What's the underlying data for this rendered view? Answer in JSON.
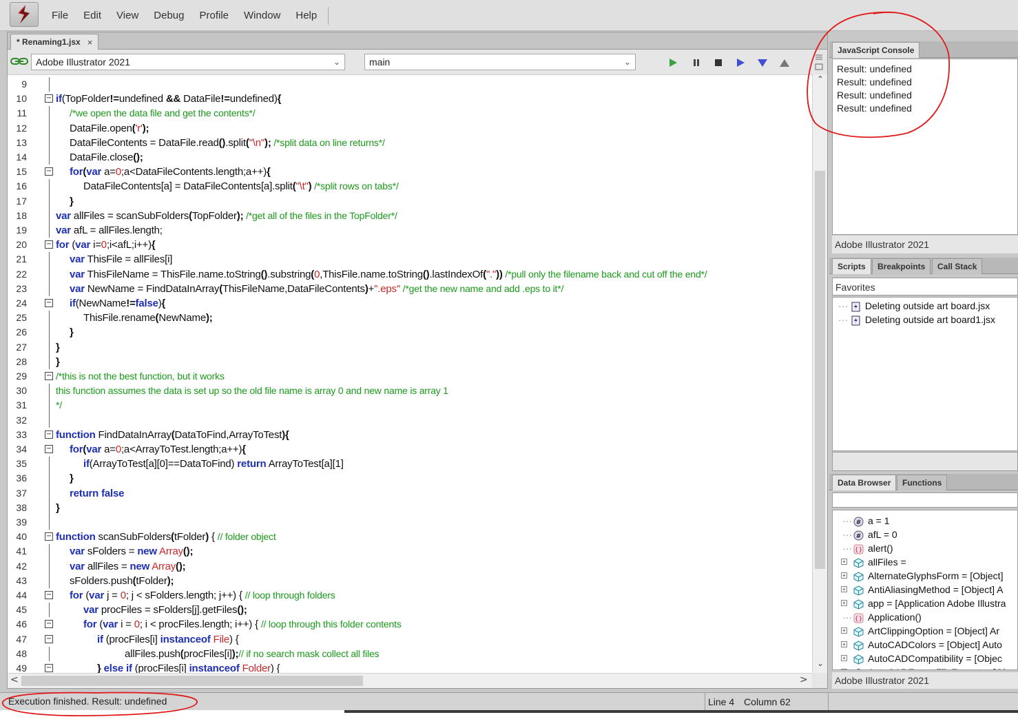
{
  "menubar": {
    "items": [
      "File",
      "Edit",
      "View",
      "Debug",
      "Profile",
      "Window",
      "Help"
    ]
  },
  "editor": {
    "tab_label": "* Renaming1.jsx",
    "tab_close": "×",
    "target": "Adobe Illustrator 2021",
    "function": "main",
    "toolbar_icons": [
      "run-icon",
      "pause-icon",
      "stop-icon",
      "step-over-icon",
      "step-into-icon",
      "step-out-icon"
    ],
    "scroll_left": "<",
    "scroll_right": ">",
    "lines": [
      {
        "n": "9",
        "indent": 0,
        "segs": []
      },
      {
        "n": "10",
        "indent": 0,
        "segs": [
          [
            "kw",
            "if"
          ],
          [
            "",
            "(TopFolder"
          ],
          [
            "op",
            "!="
          ],
          [
            "",
            "undefined "
          ],
          [
            "op",
            "&&"
          ],
          [
            "",
            " DataFile"
          ],
          [
            "op",
            "!="
          ],
          [
            "",
            "undefined)"
          ],
          [
            "op",
            "{"
          ]
        ]
      },
      {
        "n": "11",
        "indent": 1,
        "segs": [
          [
            "cm",
            "/*we open the data file and get the contents*/"
          ]
        ]
      },
      {
        "n": "12",
        "indent": 1,
        "segs": [
          [
            "",
            "DataFile.open"
          ],
          [
            "op",
            "("
          ],
          [
            "st",
            "'r'"
          ],
          [
            "op",
            ");"
          ]
        ]
      },
      {
        "n": "13",
        "indent": 1,
        "segs": [
          [
            "",
            "DataFileContents = DataFile.read"
          ],
          [
            "op",
            "()"
          ],
          [
            "",
            ".split"
          ],
          [
            "op",
            "("
          ],
          [
            "st",
            "\"\\n\""
          ],
          [
            "op",
            ");"
          ],
          [
            "cm",
            " /*split data on line returns*/"
          ]
        ]
      },
      {
        "n": "14",
        "indent": 1,
        "segs": [
          [
            "",
            "DataFile.close"
          ],
          [
            "op",
            "();"
          ]
        ]
      },
      {
        "n": "15",
        "indent": 1,
        "segs": [
          [
            "kw",
            "for"
          ],
          [
            "op",
            "("
          ],
          [
            "kw",
            "var"
          ],
          [
            "",
            " a="
          ],
          [
            "nm",
            "0"
          ],
          [
            "",
            ";a<DataFileContents.length;a++)"
          ],
          [
            "op",
            "{"
          ]
        ]
      },
      {
        "n": "16",
        "indent": 2,
        "segs": [
          [
            "",
            "DataFileContents[a] = DataFileContents[a].split"
          ],
          [
            "op",
            "("
          ],
          [
            "st",
            "\"\\t\""
          ],
          [
            "op",
            ")"
          ],
          [
            "cm",
            " /*split rows on tabs*/"
          ]
        ]
      },
      {
        "n": "17",
        "indent": 1,
        "segs": [
          [
            "op",
            "}"
          ]
        ]
      },
      {
        "n": "18",
        "indent": 0,
        "segs": [
          [
            "kw",
            "var"
          ],
          [
            "",
            " allFiles = scanSubFolders"
          ],
          [
            "op",
            "("
          ],
          [
            "",
            "TopFolder"
          ],
          [
            "op",
            ");"
          ],
          [
            "cm",
            " /*get all of the files in the TopFolder*/"
          ]
        ]
      },
      {
        "n": "19",
        "indent": 0,
        "segs": [
          [
            "kw",
            "var"
          ],
          [
            "",
            " afL = allFiles.length;"
          ]
        ]
      },
      {
        "n": "20",
        "indent": 0,
        "segs": [
          [
            "kw",
            "for"
          ],
          [
            "",
            " ("
          ],
          [
            "kw",
            "var"
          ],
          [
            "",
            " i="
          ],
          [
            "nm",
            "0"
          ],
          [
            "",
            ";i<afL;i++)"
          ],
          [
            "op",
            "{"
          ]
        ]
      },
      {
        "n": "21",
        "indent": 1,
        "segs": [
          [
            "kw",
            "var"
          ],
          [
            "",
            " ThisFile = allFiles[i]"
          ]
        ]
      },
      {
        "n": "22",
        "indent": 1,
        "segs": [
          [
            "kw",
            "var"
          ],
          [
            "",
            " ThisFileName = ThisFile.name.toString"
          ],
          [
            "op",
            "()"
          ],
          [
            "",
            ".substring"
          ],
          [
            "op",
            "("
          ],
          [
            "nm",
            "0"
          ],
          [
            "",
            ",ThisFile.name.toString"
          ],
          [
            "op",
            "()"
          ],
          [
            "",
            ".lastIndexOf"
          ],
          [
            "op",
            "("
          ],
          [
            "st",
            "\".\""
          ],
          [
            "op",
            "))"
          ],
          [
            "cm",
            " /*pull only the filename back and cut off the end*/"
          ]
        ]
      },
      {
        "n": "23",
        "indent": 1,
        "segs": [
          [
            "kw",
            "var"
          ],
          [
            "",
            " NewName = FindDataInArray"
          ],
          [
            "op",
            "("
          ],
          [
            "",
            "ThisFileName,DataFileContents"
          ],
          [
            "op",
            ")"
          ],
          [
            "",
            "+"
          ],
          [
            "st",
            "\".eps\""
          ],
          [
            "cm",
            " /*get the new name and add .eps to it*/"
          ]
        ]
      },
      {
        "n": "24",
        "indent": 1,
        "segs": [
          [
            "kw",
            "if"
          ],
          [
            "",
            "(NewName"
          ],
          [
            "op",
            "!="
          ],
          [
            "kw",
            "false"
          ],
          [
            "",
            ")"
          ],
          [
            "op",
            "{"
          ]
        ]
      },
      {
        "n": "25",
        "indent": 2,
        "segs": [
          [
            "",
            "ThisFile.rename"
          ],
          [
            "op",
            "("
          ],
          [
            "",
            "NewName"
          ],
          [
            "op",
            ");"
          ]
        ]
      },
      {
        "n": "26",
        "indent": 1,
        "segs": [
          [
            "op",
            "}"
          ]
        ]
      },
      {
        "n": "27",
        "indent": 0,
        "segs": [
          [
            "op",
            "}"
          ]
        ]
      },
      {
        "n": "28",
        "indent": 0,
        "segs": [
          [
            "op",
            "}"
          ]
        ]
      },
      {
        "n": "29",
        "indent": 0,
        "segs": [
          [
            "cm",
            "/*this is not the best function, but it works"
          ]
        ]
      },
      {
        "n": "30",
        "indent": 0,
        "segs": [
          [
            "cm",
            "this function assumes the data is set up so the old file name is array 0 and new name is array 1"
          ]
        ]
      },
      {
        "n": "31",
        "indent": 0,
        "segs": [
          [
            "cm",
            "*/"
          ]
        ]
      },
      {
        "n": "32",
        "indent": 0,
        "segs": []
      },
      {
        "n": "33",
        "indent": 0,
        "segs": [
          [
            "kw",
            "function"
          ],
          [
            "",
            " FindDataInArray"
          ],
          [
            "op",
            "("
          ],
          [
            "",
            "DataToFind,ArrayToTest"
          ],
          [
            "op",
            "){"
          ]
        ]
      },
      {
        "n": "34",
        "indent": 1,
        "segs": [
          [
            "kw",
            "for"
          ],
          [
            "op",
            "("
          ],
          [
            "kw",
            "var"
          ],
          [
            "",
            " a="
          ],
          [
            "nm",
            "0"
          ],
          [
            "",
            ";a<ArrayToTest.length;a++)"
          ],
          [
            "op",
            "{"
          ]
        ]
      },
      {
        "n": "35",
        "indent": 2,
        "segs": [
          [
            "kw",
            "if"
          ],
          [
            "",
            "(ArrayToTest[a][0]==DataToFind) "
          ],
          [
            "kw",
            "return"
          ],
          [
            "",
            " ArrayToTest[a][1]"
          ]
        ]
      },
      {
        "n": "36",
        "indent": 1,
        "segs": [
          [
            "op",
            "}"
          ]
        ]
      },
      {
        "n": "37",
        "indent": 1,
        "segs": [
          [
            "kw",
            "return false"
          ]
        ]
      },
      {
        "n": "38",
        "indent": 0,
        "segs": [
          [
            "op",
            "}"
          ]
        ]
      },
      {
        "n": "39",
        "indent": 0,
        "segs": []
      },
      {
        "n": "40",
        "indent": 0,
        "segs": [
          [
            "kw",
            "function"
          ],
          [
            "",
            " scanSubFolders"
          ],
          [
            "op",
            "("
          ],
          [
            "",
            "tFolder"
          ],
          [
            "op",
            ")"
          ],
          [
            "",
            " { "
          ],
          [
            "cm",
            "// folder object"
          ]
        ]
      },
      {
        "n": "41",
        "indent": 1,
        "segs": [
          [
            "kw",
            "var"
          ],
          [
            "",
            " sFolders = "
          ],
          [
            "kw",
            "new"
          ],
          [
            "",
            " "
          ],
          [
            "ty",
            "Array"
          ],
          [
            "op",
            "();"
          ]
        ]
      },
      {
        "n": "42",
        "indent": 1,
        "segs": [
          [
            "kw",
            "var"
          ],
          [
            "",
            " allFiles = "
          ],
          [
            "kw",
            "new"
          ],
          [
            "",
            " "
          ],
          [
            "ty",
            "Array"
          ],
          [
            "op",
            "();"
          ]
        ]
      },
      {
        "n": "43",
        "indent": 1,
        "segs": [
          [
            "",
            "sFolders.push"
          ],
          [
            "op",
            "("
          ],
          [
            "",
            "tFolder"
          ],
          [
            "op",
            ");"
          ]
        ]
      },
      {
        "n": "44",
        "indent": 1,
        "segs": [
          [
            "kw",
            "for"
          ],
          [
            "",
            " ("
          ],
          [
            "kw",
            "var"
          ],
          [
            "",
            " j = "
          ],
          [
            "nm",
            "0"
          ],
          [
            "",
            "; j < sFolders.length; j++) { "
          ],
          [
            "cm",
            "// loop through folders"
          ]
        ]
      },
      {
        "n": "45",
        "indent": 2,
        "segs": [
          [
            "kw",
            "var"
          ],
          [
            "",
            " procFiles = sFolders[j].getFiles"
          ],
          [
            "op",
            "();"
          ]
        ]
      },
      {
        "n": "46",
        "indent": 2,
        "segs": [
          [
            "kw",
            "for"
          ],
          [
            "",
            " ("
          ],
          [
            "kw",
            "var"
          ],
          [
            "",
            " i = "
          ],
          [
            "nm",
            "0"
          ],
          [
            "",
            "; i < procFiles.length; i++) { "
          ],
          [
            "cm",
            "// loop through this folder contents"
          ]
        ]
      },
      {
        "n": "47",
        "indent": 3,
        "segs": [
          [
            "kw",
            "if"
          ],
          [
            "",
            " (procFiles[i] "
          ],
          [
            "kw",
            "instanceof"
          ],
          [
            "",
            " "
          ],
          [
            "ty",
            "File"
          ],
          [
            "",
            ") {"
          ]
        ]
      },
      {
        "n": "48",
        "indent": 5,
        "segs": [
          [
            "",
            "allFiles.push"
          ],
          [
            "op",
            "("
          ],
          [
            "",
            "procFiles[i]"
          ],
          [
            "op",
            ");"
          ],
          [
            "cm",
            "// if no search mask collect all files"
          ]
        ]
      },
      {
        "n": "49",
        "indent": 3,
        "segs": [
          [
            "op",
            "} "
          ],
          [
            "kw",
            "else if"
          ],
          [
            "",
            " (procFiles[i] "
          ],
          [
            "kw",
            "instanceof"
          ],
          [
            "",
            " "
          ],
          [
            "ty",
            "Folder"
          ],
          [
            "",
            ") {"
          ]
        ]
      }
    ]
  },
  "status": {
    "message": "Execution finished. Result: undefined",
    "line": "Line 4",
    "column": "Column 62"
  },
  "console": {
    "tab": "JavaScript Console",
    "lines": [
      "Result: undefined",
      "Result: undefined",
      "Result: undefined",
      "Result: undefined"
    ],
    "footer": "Adobe Illustrator 2021"
  },
  "scripts_panel": {
    "tabs": [
      "Scripts",
      "Breakpoints",
      "Call Stack"
    ],
    "location": "Favorites",
    "items": [
      "Deleting outside art board.jsx",
      "Deleting outside art board1.jsx"
    ]
  },
  "data_browser": {
    "tabs": [
      "Data Browser",
      "Functions"
    ],
    "items": [
      {
        "label": "a = 1",
        "icon": "number-icon",
        "expandable": false
      },
      {
        "label": "afL = 0",
        "icon": "number-icon",
        "expandable": false
      },
      {
        "label": "alert()",
        "icon": "function-icon",
        "expandable": false
      },
      {
        "label": "allFiles =",
        "icon": "object-icon",
        "expandable": true
      },
      {
        "label": "AlternateGlyphsForm = [Object]",
        "icon": "object-icon",
        "expandable": true
      },
      {
        "label": "AntiAliasingMethod = [Object] A",
        "icon": "object-icon",
        "expandable": true
      },
      {
        "label": "app = [Application Adobe Illustra",
        "icon": "object-icon",
        "expandable": true
      },
      {
        "label": "Application()",
        "icon": "function-icon",
        "expandable": false
      },
      {
        "label": "ArtClippingOption = [Object] Ar",
        "icon": "object-icon",
        "expandable": true
      },
      {
        "label": "AutoCADColors = [Object] Auto",
        "icon": "object-icon",
        "expandable": true
      },
      {
        "label": "AutoCADCompatibility = [Objec",
        "icon": "object-icon",
        "expandable": true
      },
      {
        "label": "AutoCADExportFileFormat = [Ob",
        "icon": "object-icon",
        "expandable": true
      }
    ],
    "footer": "Adobe Illustrator 2021"
  },
  "colors": {
    "keyword": "#1e2fb0",
    "comment": "#1a9a1a",
    "string": "#c82828",
    "annotation": "#e01818"
  }
}
